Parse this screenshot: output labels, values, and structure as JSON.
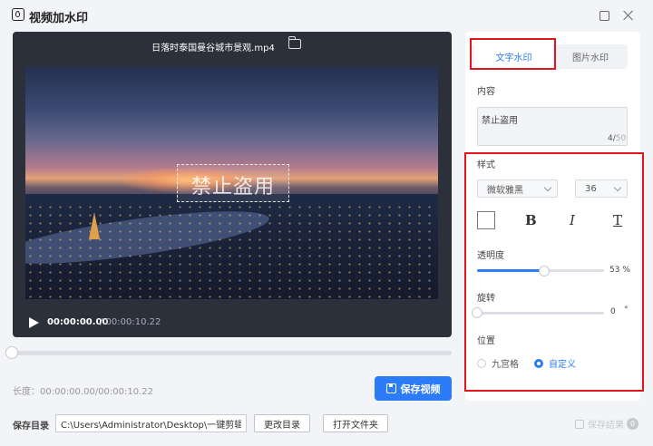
{
  "window": {
    "title": "视频加水印"
  },
  "player": {
    "file_name": "日落时泰国曼谷城市景观.mp4",
    "watermark_text": "禁止盗用",
    "current_time": "00:00:00.00",
    "total_time": "/ 00:00:10.22",
    "seek_progress": 0
  },
  "footer": {
    "length_label": "长度：00:00:00.00/00:00:10.22",
    "save_video_label": "保存视频",
    "save_dir_label": "保存目录",
    "save_dir_value": "C:\\Users\\Administrator\\Desktop\\一键剪辑",
    "change_dir_label": "更改目录",
    "open_folder_label": "打开文件夹",
    "save_result_label": "保存结果",
    "save_result_count": "0"
  },
  "panel": {
    "tabs": [
      {
        "label": "文字水印",
        "active": true
      },
      {
        "label": "图片水印",
        "active": false
      }
    ],
    "content_label": "内容",
    "content_value": "禁止盗用",
    "char_count": "4/",
    "char_max": "50",
    "style_label": "样式",
    "font_value": "微软雅黑",
    "size_value": "36",
    "bold_glyph": "B",
    "italic_glyph": "I",
    "underline_glyph": "T",
    "opacity_label": "透明度",
    "opacity_value": "53 %",
    "opacity_fraction": 0.53,
    "rotate_label": "旋转",
    "rotate_value": "0",
    "rotate_unit": "°",
    "position_label": "位置",
    "position_options": [
      {
        "label": "九宫格",
        "selected": false
      },
      {
        "label": "自定义",
        "selected": true
      }
    ]
  },
  "colors": {
    "accent": "#2b7cf6",
    "highlight": "#e0161c"
  }
}
